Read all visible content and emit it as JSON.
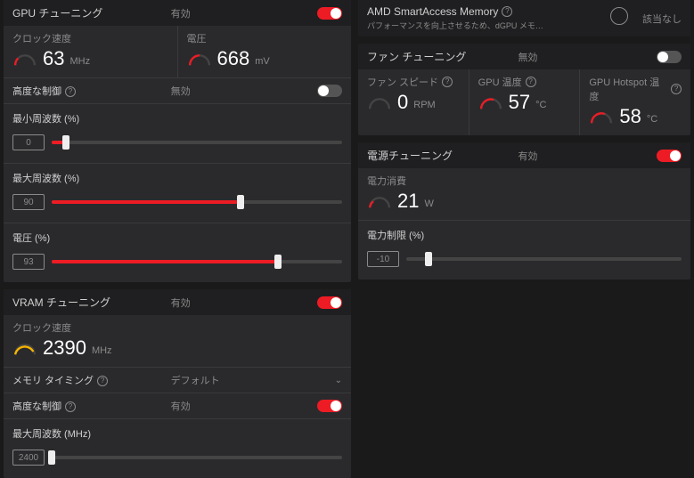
{
  "gpu": {
    "header_title": "GPU チューニング",
    "header_state": "有効",
    "toggle": true,
    "clock": {
      "label": "クロック速度",
      "value": "63",
      "unit": "MHz",
      "arc_pct": 10,
      "arc_color": "#ed1c24"
    },
    "voltage": {
      "label": "電圧",
      "value": "668",
      "unit": "mV",
      "arc_pct": 45,
      "arc_color": "#ed1c24"
    },
    "advanced": {
      "label": "高度な制御",
      "state": "無効",
      "toggle": false
    },
    "min_freq": {
      "title": "最小周波数 (%)",
      "value": "0",
      "pct": 5,
      "color": "red"
    },
    "max_freq": {
      "title": "最大周波数 (%)",
      "value": "90",
      "pct": 65,
      "color": "red"
    },
    "volt_pct": {
      "title": "電圧 (%)",
      "value": "93",
      "pct": 78,
      "color": "red"
    }
  },
  "vram": {
    "header_title": "VRAM チューニング",
    "header_state": "有効",
    "toggle": true,
    "clock": {
      "label": "クロック速度",
      "value": "2390",
      "unit": "MHz",
      "arc_pct": 90,
      "arc_color": "#f7b500"
    },
    "timing": {
      "label": "メモリ タイミング",
      "state": "デフォルト"
    },
    "advanced": {
      "label": "高度な制御",
      "state": "有効",
      "toggle": true
    },
    "max_freq": {
      "title": "最大周波数 (MHz)",
      "value": "2400",
      "pct": 0,
      "color": "yellow"
    }
  },
  "sam": {
    "title": "AMD SmartAccess Memory",
    "desc": "パフォーマンスを向上させるため、dGPU メモ…",
    "status": "該当なし"
  },
  "fan": {
    "header_title": "ファン チューニング",
    "header_state": "無効",
    "toggle": false,
    "speed": {
      "label": "ファン スピード",
      "value": "0",
      "unit": "RPM",
      "arc_pct": 0,
      "arc_color": "#8a8a8a"
    },
    "temp": {
      "label": "GPU 温度",
      "value": "57",
      "unit": "°C",
      "arc_pct": 55,
      "arc_color": "#ed1c24"
    },
    "hotspot": {
      "label": "GPU Hotspot 温度",
      "value": "58",
      "unit": "°C",
      "arc_pct": 58,
      "arc_color": "#ed1c24"
    }
  },
  "power": {
    "header_title": "電源チューニング",
    "header_state": "有効",
    "toggle": true,
    "draw": {
      "label": "電力消費",
      "value": "21",
      "unit": "W",
      "arc_pct": 15,
      "arc_color": "#ed1c24"
    },
    "limit": {
      "title": "電力制限 (%)",
      "value": "-10",
      "pct": 8,
      "color": "grey"
    }
  }
}
